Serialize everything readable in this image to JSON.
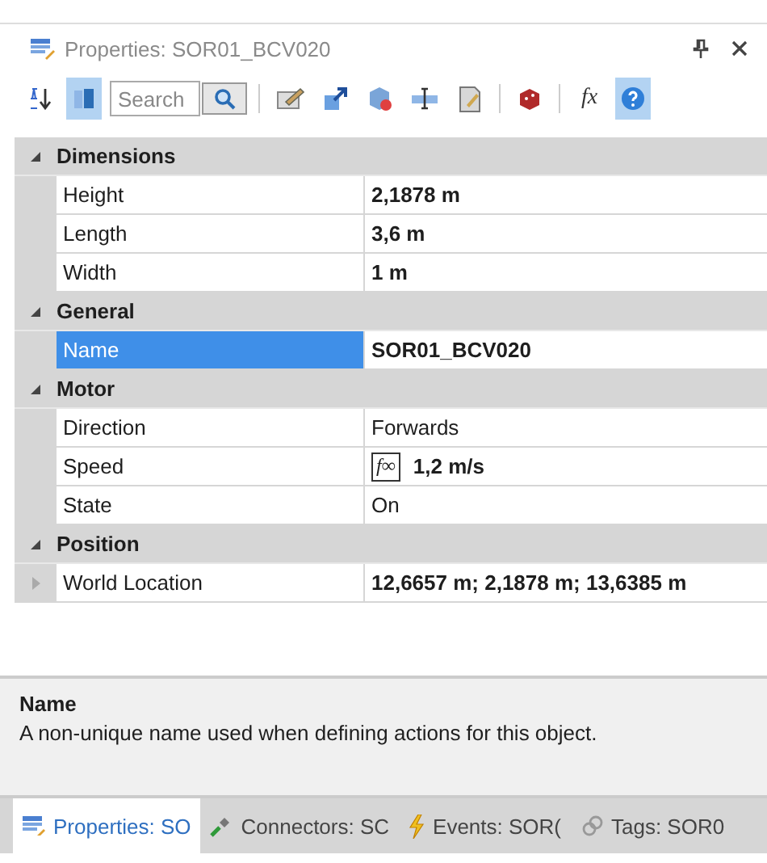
{
  "panel": {
    "title": "Properties: SOR01_BCV020"
  },
  "toolbar": [
    {
      "kind": "sort",
      "selected": false
    },
    {
      "kind": "categorized",
      "selected": true
    },
    {
      "kind": "search",
      "placeholder": "Search"
    },
    {
      "kind": "separator"
    },
    {
      "kind": "edit",
      "selected": false
    },
    {
      "kind": "arrow",
      "selected": false
    },
    {
      "kind": "cube",
      "selected": false
    },
    {
      "kind": "text",
      "selected": false
    },
    {
      "kind": "page",
      "selected": false
    },
    {
      "kind": "separator"
    },
    {
      "kind": "dice",
      "selected": false
    },
    {
      "kind": "separator"
    },
    {
      "kind": "fx",
      "label": "fx",
      "selected": false
    },
    {
      "kind": "help",
      "selected": true
    }
  ],
  "categories": [
    {
      "name": "Dimensions",
      "expanded": true,
      "rows": [
        {
          "name": "Height",
          "value": "2,1878 m",
          "bold": true,
          "selected": false,
          "kind": "plain"
        },
        {
          "name": "Length",
          "value": "3,6 m",
          "bold": true,
          "selected": false,
          "kind": "plain"
        },
        {
          "name": "Width",
          "value": "1 m",
          "bold": true,
          "selected": false,
          "kind": "plain"
        }
      ]
    },
    {
      "name": "General",
      "expanded": true,
      "rows": [
        {
          "name": "Name",
          "value": "SOR01_BCV020",
          "bold": true,
          "selected": true,
          "kind": "plain"
        }
      ]
    },
    {
      "name": "Motor",
      "expanded": true,
      "rows": [
        {
          "name": "Direction",
          "value": "Forwards",
          "bold": false,
          "selected": false,
          "kind": "plain"
        },
        {
          "name": "Speed",
          "value": "1,2 m/s",
          "bold": true,
          "selected": false,
          "kind": "formula",
          "formula": "f∞"
        },
        {
          "name": "State",
          "value": "On",
          "bold": false,
          "selected": false,
          "kind": "plain"
        }
      ]
    },
    {
      "name": "Position",
      "expanded": true,
      "rows": [
        {
          "name": "World Location",
          "value": "12,6657 m; 2,1878 m; 13,6385 m",
          "bold": true,
          "selected": false,
          "kind": "expandable",
          "expanded": false
        }
      ]
    }
  ],
  "description": {
    "title": "Name",
    "text": "A non-unique name used when defining actions for this object."
  },
  "tabs": [
    {
      "label": "Properties: SO",
      "selected": true
    },
    {
      "label": "Connectors: SC",
      "selected": false
    },
    {
      "label": "Events: SOR(",
      "selected": false
    },
    {
      "label": "Tags: SOR0",
      "selected": false
    }
  ]
}
